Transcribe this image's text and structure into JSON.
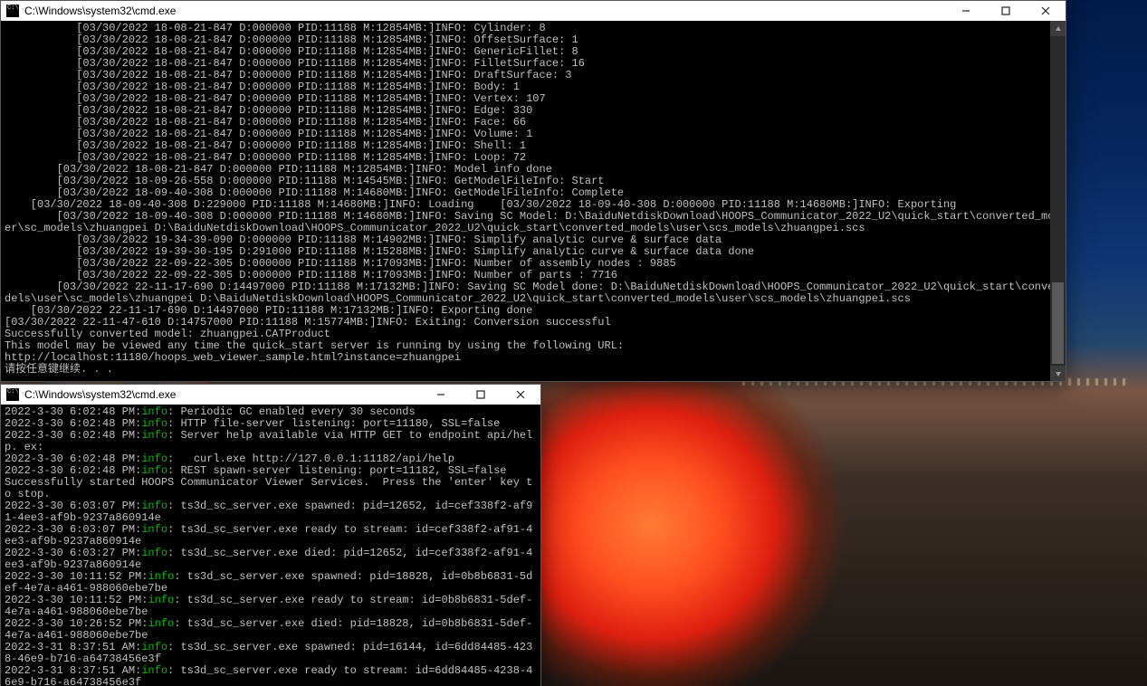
{
  "win1": {
    "title": "C:\\Windows\\system32\\cmd.exe",
    "lines": [
      "           [03/30/2022 18-08-21-847 D:000000 PID:11188 M:12854MB:]INFO: Cylinder: 8",
      "           [03/30/2022 18-08-21-847 D:000000 PID:11188 M:12854MB:]INFO: OffsetSurface: 1",
      "           [03/30/2022 18-08-21-847 D:000000 PID:11188 M:12854MB:]INFO: GenericFillet: 8",
      "           [03/30/2022 18-08-21-847 D:000000 PID:11188 M:12854MB:]INFO: FilletSurface: 16",
      "           [03/30/2022 18-08-21-847 D:000000 PID:11188 M:12854MB:]INFO: DraftSurface: 3",
      "           [03/30/2022 18-08-21-847 D:000000 PID:11188 M:12854MB:]INFO: Body: 1",
      "           [03/30/2022 18-08-21-847 D:000000 PID:11188 M:12854MB:]INFO: Vertex: 107",
      "           [03/30/2022 18-08-21-847 D:000000 PID:11188 M:12854MB:]INFO: Edge: 330",
      "           [03/30/2022 18-08-21-847 D:000000 PID:11188 M:12854MB:]INFO: Face: 66",
      "           [03/30/2022 18-08-21-847 D:000000 PID:11188 M:12854MB:]INFO: Volume: 1",
      "           [03/30/2022 18-08-21-847 D:000000 PID:11188 M:12854MB:]INFO: Shell: 1",
      "           [03/30/2022 18-08-21-847 D:000000 PID:11188 M:12854MB:]INFO: Loop: 72",
      "        [03/30/2022 18-08-21-847 D:000000 PID:11188 M:12854MB:]INFO: Model info done",
      "        [03/30/2022 18-09-26-558 D:000000 PID:11188 M:14545MB:]INFO: GetModelFileInfo: Start",
      "        [03/30/2022 18-09-40-308 D:000000 PID:11188 M:14680MB:]INFO: GetModelFileInfo: Complete",
      "    [03/30/2022 18-09-40-308 D:229000 PID:11188 M:14680MB:]INFO: Loading    [03/30/2022 18-09-40-308 D:000000 PID:11188 M:14680MB:]INFO: Exporting",
      "        [03/30/2022 18-09-40-308 D:000000 PID:11188 M:14680MB:]INFO: Saving SC Model: D:\\BaiduNetdiskDownload\\HOOPS_Communicator_2022_U2\\quick_start\\converted_models\\us",
      "er\\sc_models\\zhuangpei D:\\BaiduNetdiskDownload\\HOOPS_Communicator_2022_U2\\quick_start\\converted_models\\user\\scs_models\\zhuangpei.scs",
      "           [03/30/2022 19-34-39-090 D:000000 PID:11188 M:14902MB:]INFO: Simplify analytic curve & surface data",
      "           [03/30/2022 19-39-30-195 D:291000 PID:11188 M:15288MB:]INFO: Simplify analytic curve & surface data done",
      "           [03/30/2022 22-09-22-305 D:000000 PID:11188 M:17093MB:]INFO: Number of assembly nodes : 9885",
      "           [03/30/2022 22-09-22-305 D:000000 PID:11188 M:17093MB:]INFO: Number of parts : 7716",
      "        [03/30/2022 22-11-17-690 D:14497000 PID:11188 M:17132MB:]INFO: Saving SC Model done: D:\\BaiduNetdiskDownload\\HOOPS_Communicator_2022_U2\\quick_start\\converted_mo",
      "dels\\user\\sc_models\\zhuangpei D:\\BaiduNetdiskDownload\\HOOPS_Communicator_2022_U2\\quick_start\\converted_models\\user\\scs_models\\zhuangpei.scs",
      "    [03/30/2022 22-11-17-690 D:14497000 PID:11188 M:17132MB:]INFO: Exporting done",
      "[03/30/2022 22-11-47-610 D:14757000 PID:11188 M:15774MB:]INFO: Exiting: Conversion successful",
      "Successfully converted model: zhuangpei.CATProduct",
      "This model may be viewed any time the quick_start server is running by using the following URL:",
      "http://localhost:11180/hoops_web_viewer_sample.html?instance=zhuangpei",
      "请按任意键继续. . ."
    ]
  },
  "win2": {
    "title": "C:\\Windows\\system32\\cmd.exe",
    "entries": [
      {
        "ts": "2022-3-30 6:02:48 PM:",
        "lvl": "info",
        "msg": ": Periodic GC enabled every 30 seconds"
      },
      {
        "ts": "2022-3-30 6:02:48 PM:",
        "lvl": "info",
        "msg": ": HTTP file-server listening: port=11180, SSL=false"
      },
      {
        "ts": "2022-3-30 6:02:48 PM:",
        "lvl": "info",
        "msg": ": Server help available via HTTP GET to endpoint api/help. ex:"
      },
      {
        "ts": "2022-3-30 6:02:48 PM:",
        "lvl": "info",
        "msg": ":   curl.exe http://127.0.0.1:11182/api/help"
      },
      {
        "ts": "2022-3-30 6:02:48 PM:",
        "lvl": "info",
        "msg": ": REST spawn-server listening: port=11182, SSL=false"
      },
      {
        "plain": ""
      },
      {
        "plain": "Successfully started HOOPS Communicator Viewer Services.  Press the 'enter' key to stop."
      },
      {
        "ts": "2022-3-30 6:03:07 PM:",
        "lvl": "info",
        "msg": ": ts3d_sc_server.exe spawned: pid=12652, id=cef338f2-af91-4ee3-af9b-9237a860914e"
      },
      {
        "ts": "2022-3-30 6:03:07 PM:",
        "lvl": "info",
        "msg": ": ts3d_sc_server.exe ready to stream: id=cef338f2-af91-4ee3-af9b-9237a860914e"
      },
      {
        "ts": "2022-3-30 6:03:27 PM:",
        "lvl": "info",
        "msg": ": ts3d_sc_server.exe died: pid=12652, id=cef338f2-af91-4ee3-af9b-9237a860914e"
      },
      {
        "ts": "2022-3-30 10:11:52 PM:",
        "lvl": "info",
        "msg": ": ts3d_sc_server.exe spawned: pid=18828, id=0b8b6831-5def-4e7a-a461-988060ebe7be"
      },
      {
        "ts": "2022-3-30 10:11:52 PM:",
        "lvl": "info",
        "msg": ": ts3d_sc_server.exe ready to stream: id=0b8b6831-5def-4e7a-a461-988060ebe7be"
      },
      {
        "ts": "2022-3-30 10:26:52 PM:",
        "lvl": "info",
        "msg": ": ts3d_sc_server.exe died: pid=18828, id=0b8b6831-5def-4e7a-a461-988060ebe7be"
      },
      {
        "ts": "2022-3-31 8:37:51 AM:",
        "lvl": "info",
        "msg": ": ts3d_sc_server.exe spawned: pid=16144, id=6dd84485-4238-46e9-b716-a64738456e3f"
      },
      {
        "ts": "2022-3-31 8:37:51 AM:",
        "lvl": "info",
        "msg": ": ts3d_sc_server.exe ready to stream: id=6dd84485-4238-46e9-b716-a64738456e3f"
      }
    ]
  }
}
